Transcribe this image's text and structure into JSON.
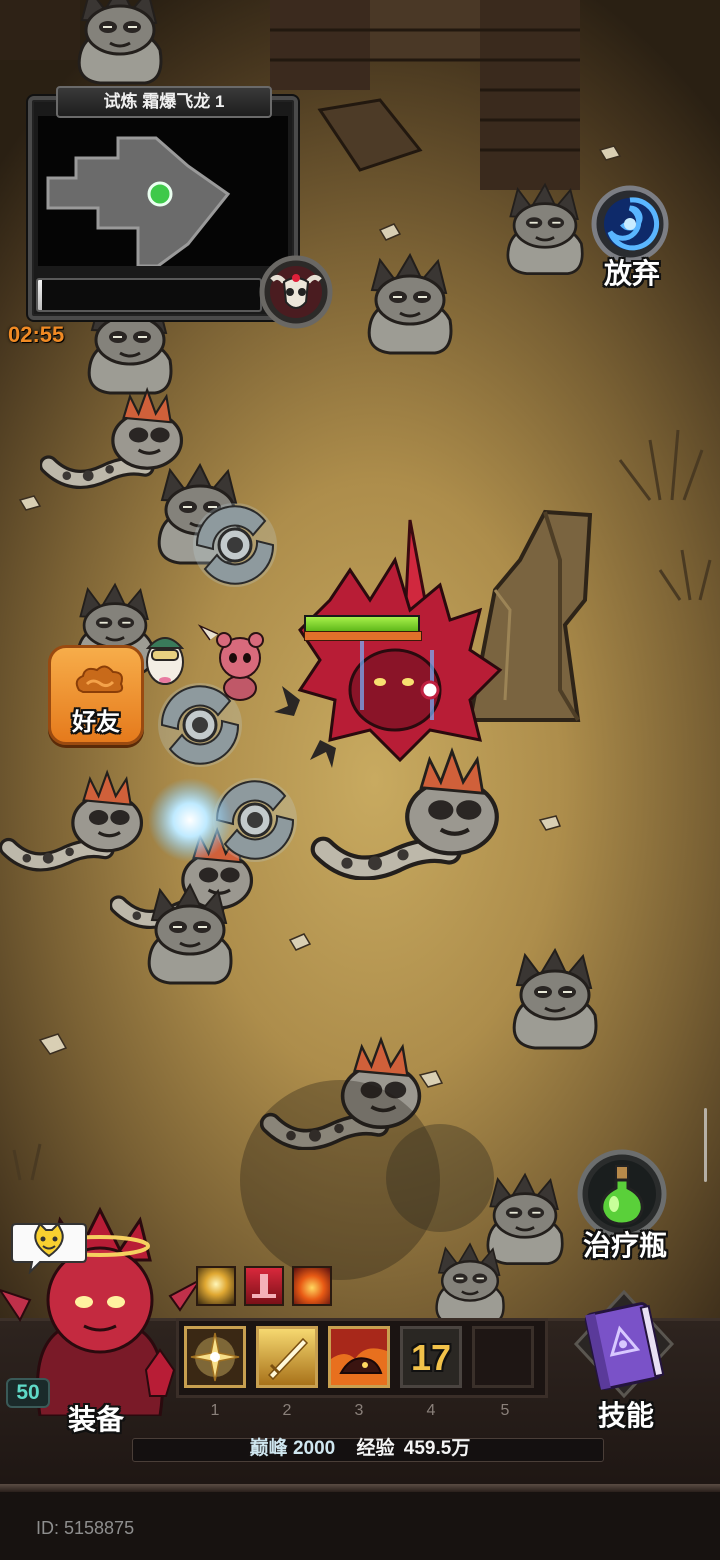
{
  "minimap": {
    "title": "试炼 霜爆飞龙 1",
    "player_marker": "green-dot",
    "boss_progress": 0.02,
    "boss_icon": "bull-skull-icon"
  },
  "timer": "02:55",
  "abandon": {
    "label": "放弃",
    "icon": "portal-icon"
  },
  "friends": {
    "label": "好友",
    "icon": "cloud-icon"
  },
  "player": {
    "health": 1.0,
    "level": "50",
    "equip_label": "装备",
    "chat_icon": "cat-face-icon"
  },
  "heal": {
    "label": "治疗瓶",
    "icon": "green-potion-icon"
  },
  "buffs": [
    {
      "icon": "sun-glow-buff-icon"
    },
    {
      "icon": "red-altar-buff-icon"
    },
    {
      "icon": "flame-buff-icon"
    }
  ],
  "skills": {
    "label": "技能",
    "icon": "purple-spellbook-icon",
    "slots": [
      {
        "key": "1",
        "icon": "holy-sword-icon"
      },
      {
        "key": "2",
        "icon": "golden-blade-icon"
      },
      {
        "key": "3",
        "icon": "fire-beast-icon"
      },
      {
        "key": "4",
        "icon": "cooldown-icon",
        "cooldown": "17"
      },
      {
        "key": "5",
        "icon": "empty-slot"
      }
    ]
  },
  "status": {
    "peak_label": "巅峰",
    "peak_value": "2000",
    "exp_label": "经验",
    "exp_value": "459.5万"
  },
  "account": {
    "id_text": "ID: 5158875"
  },
  "colors": {
    "timer": "#f08a24",
    "friends_button": "#f29a32",
    "health": "#7ed321",
    "level": "#5fd9c8",
    "cooldown": "#f2c24a"
  }
}
